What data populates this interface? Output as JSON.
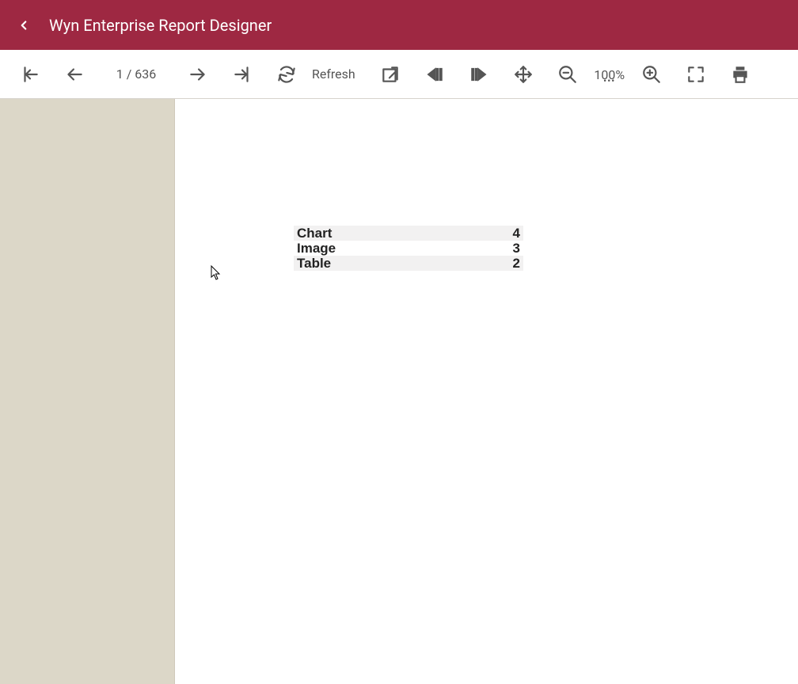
{
  "header": {
    "title": "Wyn Enterprise Report Designer"
  },
  "toolbar": {
    "page_indicator": "1 / 636",
    "refresh_label": "Refresh",
    "zoom_label": "100%"
  },
  "report": {
    "rows": [
      {
        "label": "Chart",
        "value": "4"
      },
      {
        "label": "Image",
        "value": "3"
      },
      {
        "label": "Table",
        "value": "2"
      }
    ]
  }
}
